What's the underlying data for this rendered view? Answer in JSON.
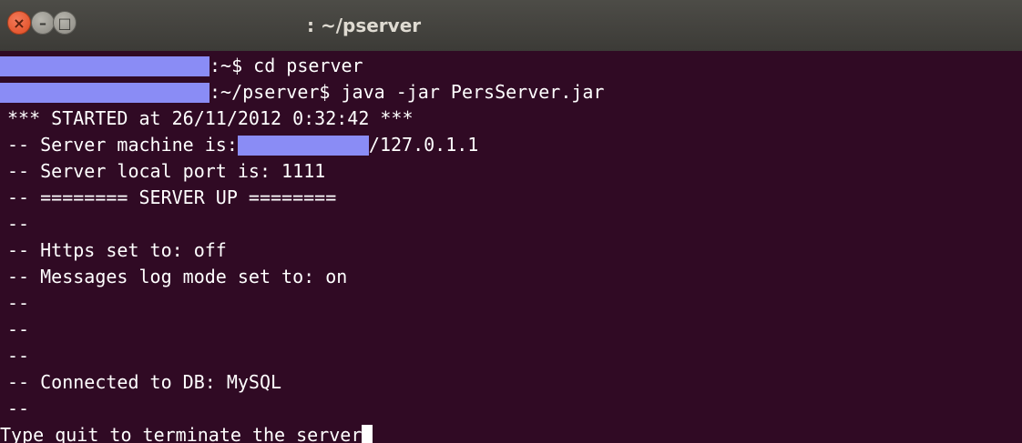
{
  "window": {
    "title": ": ~/pserver",
    "buttons": {
      "close_glyph": "×",
      "minimize_glyph": "–",
      "maximize_glyph": "□"
    }
  },
  "terminal": {
    "background": "#300a24",
    "foreground": "#ffffff",
    "redaction_color": "#8a8cf5",
    "prompt1": ":~$ cd pserver",
    "prompt2": ":~/pserver$ java -jar PersServer.jar",
    "started": "*** STARTED at 26/11/2012 0:32:42 ***",
    "machine_prefix": "-- Server machine is: ",
    "machine_suffix": "/127.0.1.1",
    "port": "-- Server local port is: 1111",
    "server_up": "-- ======== SERVER UP ========",
    "dash": "--",
    "https": "-- Https set to: off",
    "log_mode": "-- Messages log mode set to: on",
    "db": "-- Connected to DB: MySQL",
    "quit_prompt": "Type quit to terminate the server"
  }
}
